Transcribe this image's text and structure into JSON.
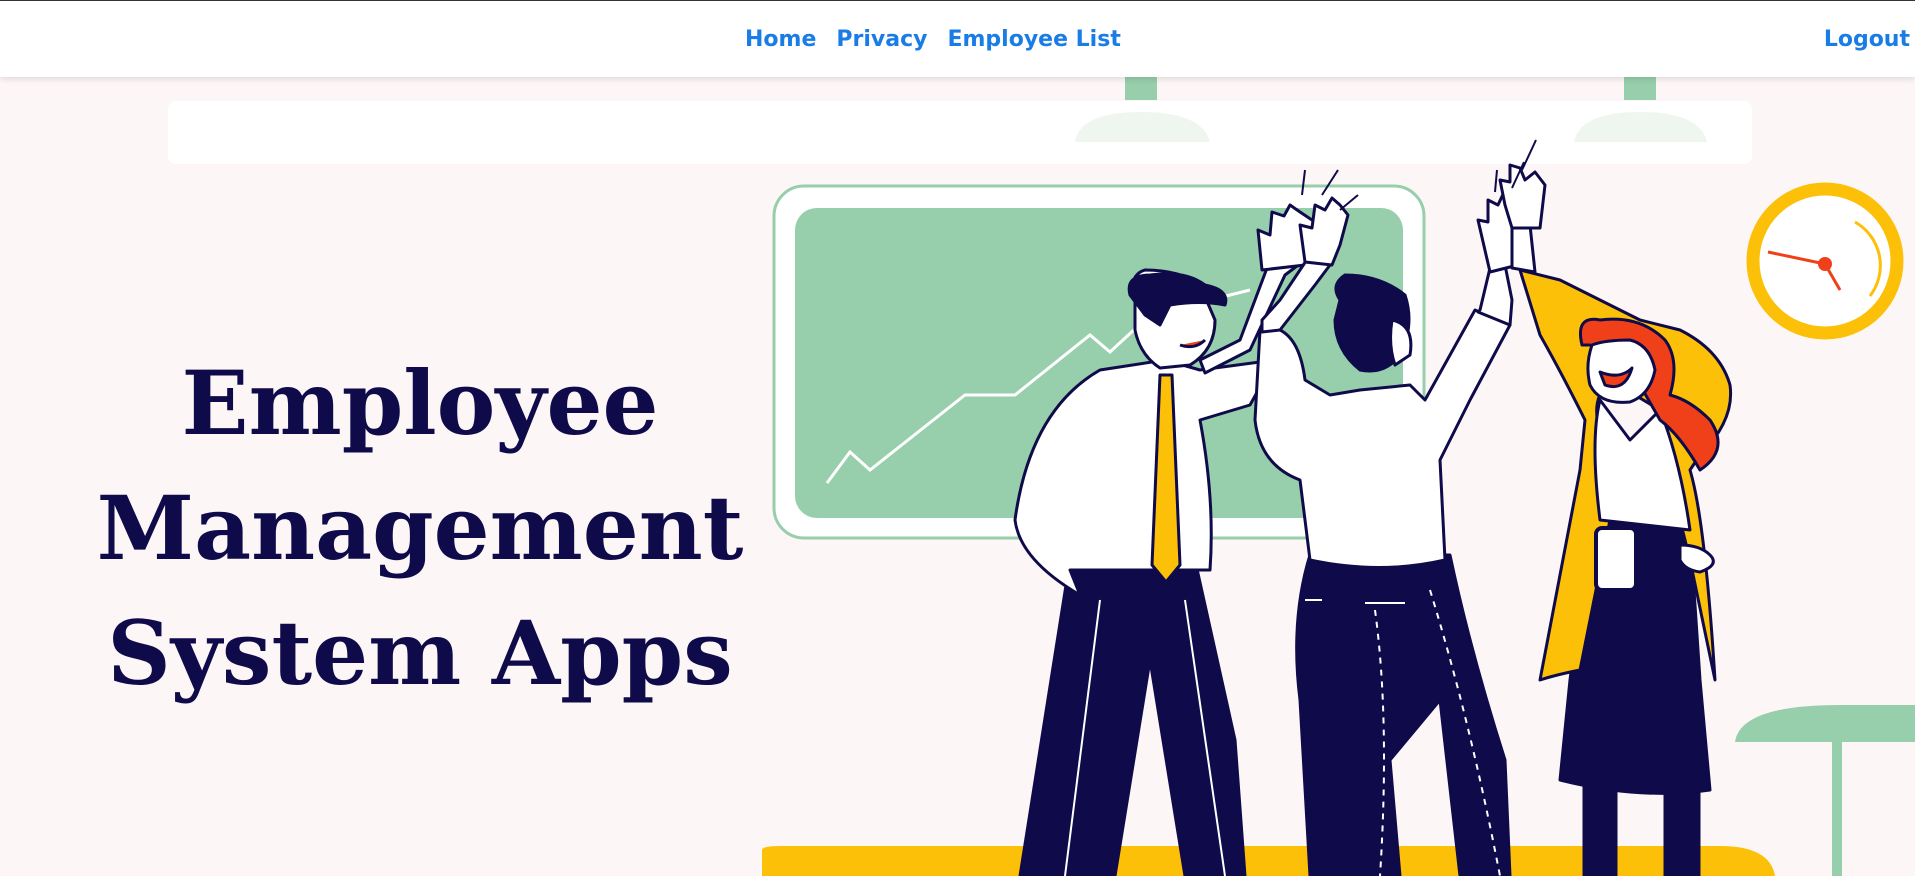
{
  "nav": {
    "home": "Home",
    "privacy": "Privacy",
    "employee_list": "Employee List",
    "logout": "Logout"
  },
  "hero": {
    "line1": "Employee",
    "line2": "Management",
    "line3": "System Apps"
  },
  "illustration": {
    "subject": "three office workers giving high fives",
    "icons": [
      "chart-board-icon",
      "wall-clock-icon",
      "ceiling-lamp-icon",
      "side-table-icon"
    ]
  },
  "colors": {
    "accent_link": "#1a7de6",
    "title_navy": "#0f0b4a",
    "green": "#97ceab",
    "yellow": "#fdc008",
    "orange_hair": "#f0401a",
    "background": "#fdf6f6"
  }
}
